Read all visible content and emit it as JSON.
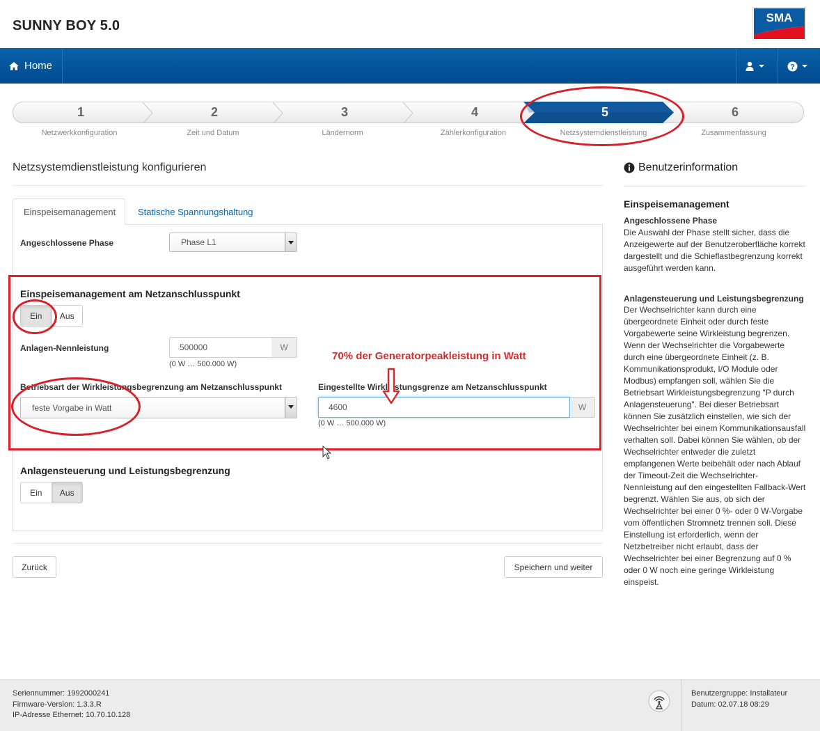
{
  "header": {
    "device_title": "SUNNY BOY 5.0",
    "logo_text": "SMA"
  },
  "nav": {
    "home_label": "Home",
    "user_icon": "user-icon",
    "help_icon": "help-icon"
  },
  "wizard": {
    "steps": [
      {
        "num": "1",
        "label": "Netzwerkkonfiguration"
      },
      {
        "num": "2",
        "label": "Zeit und Datum"
      },
      {
        "num": "3",
        "label": "Ländernorm"
      },
      {
        "num": "4",
        "label": "Zählerkonfiguration"
      },
      {
        "num": "5",
        "label": "Netzsystemdienstleistung"
      },
      {
        "num": "6",
        "label": "Zusammenfassung"
      }
    ],
    "active_step": 5
  },
  "main": {
    "title": "Netzsystemdienstleistung konfigurieren",
    "tabs": [
      {
        "label": "Einspeisemanagement"
      },
      {
        "label": "Statische Spannungshaltung"
      }
    ],
    "phase_label": "Angeschlossene Phase",
    "phase_value": "Phase L1",
    "feed_section_title": "Einspeisemanagement am Netzanschlusspunkt",
    "on_label": "Ein",
    "off_label": "Aus",
    "feed_toggle": "Ein",
    "nominal_label": "Anlagen-Nennleistung",
    "nominal_value": "500000",
    "unit_w": "W",
    "range_hint": "(0 W … 500.000 W)",
    "mode_label": "Betriebsart der Wirkleistungsbegrenzung am Netzanschlusspunkt",
    "mode_value": "feste Vorgabe in Watt",
    "limit_label": "Eingestellte Wirkleistungsgrenze am Netzanschlusspunkt",
    "limit_value": "4600",
    "control_section_title": "Anlagensteuerung und Leistungsbegrenzung",
    "control_toggle": "Aus",
    "back_button": "Zurück",
    "save_button": "Speichern und weiter"
  },
  "annotation": {
    "text": "70% der Generatorpeakleistung in Watt"
  },
  "sidebar": {
    "title": "Benutzerinformation",
    "heading": "Einspeisemanagement",
    "sub1": "Angeschlossene Phase",
    "p1": "Die Auswahl der Phase stellt sicher, dass die Anzeigewerte auf der Benutzeroberfläche korrekt dargestellt und die Schieflastbegrenzung korrekt ausgeführt werden kann.",
    "sub2": "Anlagensteuerung und Leistungsbegrenzung",
    "p2": "Der Wechselrichter kann durch eine übergeordnete Einheit oder durch feste Vorgabewerte seine Wirkleistung begrenzen. Wenn der Wechselrichter die Vorgabewerte durch eine übergeordnete Einheit (z. B. Kommunikationsprodukt, I/O Module oder Modbus) empfangen soll, wählen Sie die Betriebsart Wirkleistungsbegrenzung \"P durch Anlagensteuerung\". Bei dieser Betriebsart können Sie zusätzlich einstellen, wie sich der Wechselrichter bei einem Kommunikationsausfall verhalten soll. Dabei können Sie wählen, ob der Wechselrichter entweder die zuletzt empfangenen Werte beibehält oder nach Ablauf der Timeout-Zeit die Wechselrichter-Nennleistung auf den eingestellten Fallback-Wert begrenzt. Wählen Sie aus, ob sich der Wechselrichter bei einer 0 %- oder 0 W-Vorgabe vom öffentlichen Stromnetz trennen soll. Diese Einstellung ist erforderlich, wenn der Netzbetreiber nicht erlaubt, dass der Wechselrichter bei einer Begrenzung auf 0 % oder 0 W noch eine geringe Wirkleistung einspeist."
  },
  "footer": {
    "serial": "Seriennummer: 1992000241",
    "firmware": "Firmware-Version: 1.3.3.R",
    "ip": "IP-Adresse Ethernet: 10.70.10.128",
    "user_group": "Benutzergruppe: Installateur",
    "date": "Datum: 02.07.18 08:29"
  },
  "colors": {
    "nav_blue": "#0a62a8",
    "annotation_red": "#e0202a",
    "active_step": "#0d4f8f"
  }
}
